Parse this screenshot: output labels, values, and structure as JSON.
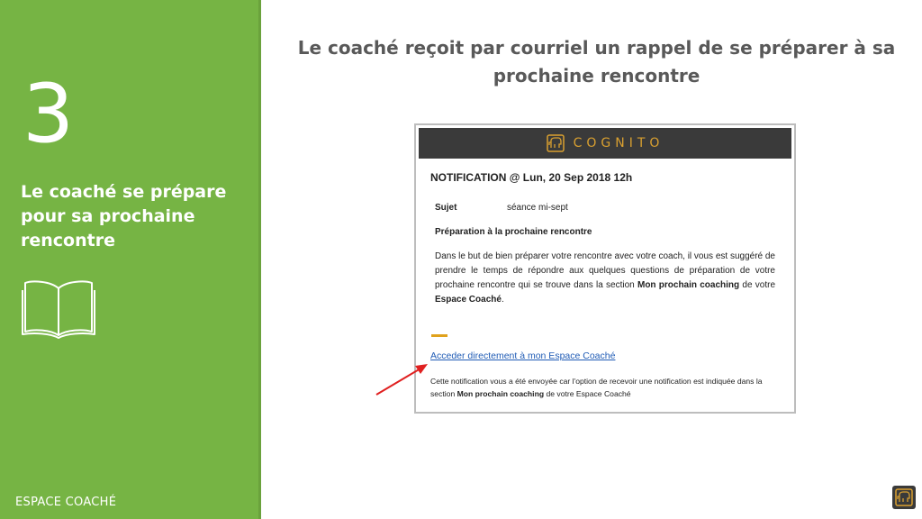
{
  "sidebar": {
    "step_number": "3",
    "step_title": "Le coaché se prépare pour sa prochaine rencontre",
    "icon": "open-book-icon",
    "footer_label": "ESPACE COACHÉ"
  },
  "main": {
    "title": "Le coaché reçoit par courriel un rappel de se préparer à sa prochaine rencontre"
  },
  "email": {
    "brand": "COGNITO",
    "brand_icon": "elephant-logo-icon",
    "notification_title": "NOTIFICATION @ Lun, 20 Sep 2018 12h",
    "subject_label": "Sujet",
    "subject_value": "séance mi-sept",
    "prep_title": "Préparation à la prochaine rencontre",
    "body_part1": "Dans le but de bien préparer votre rencontre avec votre coach, il vous est suggéré de prendre le temps de répondre aux quelques questions de préparation de votre prochaine rencontre qui se trouve dans la section ",
    "body_bold1": "Mon prochain coaching",
    "body_part2": " de votre ",
    "body_bold2": "Espace Coaché",
    "body_part3": ".",
    "link_text": "Acceder directement à mon Espace Coaché",
    "note_part1": "Cette notification vous a été envoyée car l'option de recevoir une notification est indiquée dans la section ",
    "note_bold": "Mon prochain coaching",
    "note_part2": " de votre Espace Coaché"
  },
  "colors": {
    "sidebar_green": "#76b444",
    "brand_gold": "#d9a030",
    "header_dark": "#3a3a3a",
    "accent_orange": "#e0a21c",
    "link_blue": "#1f5bb5",
    "arrow_red": "#e02020"
  }
}
